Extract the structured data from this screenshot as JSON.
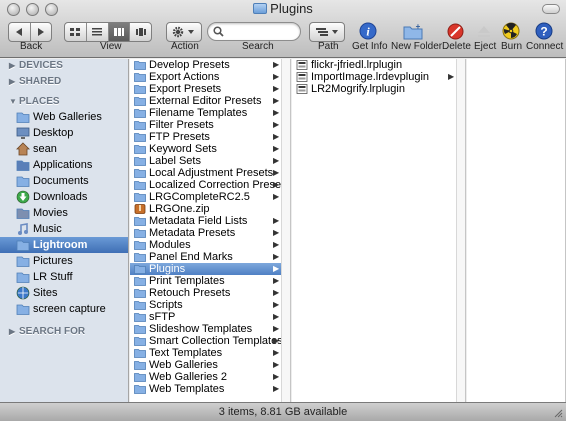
{
  "window": {
    "title": "Plugins"
  },
  "toolbar": {
    "back_label": "Back",
    "view_label": "View",
    "action_label": "Action",
    "search_label": "Search",
    "search_value": "",
    "path_label": "Path",
    "getinfo_label": "Get Info",
    "newfolder_label": "New Folder",
    "delete_label": "Delete",
    "eject_label": "Eject",
    "burn_label": "Burn",
    "connect_label": "Connect"
  },
  "sidebar": {
    "devices": "DEVICES",
    "shared": "SHARED",
    "places": "PLACES",
    "search_for": "SEARCH FOR",
    "items": [
      {
        "label": "Web Galleries",
        "icon": "folder-icon"
      },
      {
        "label": "Desktop",
        "icon": "desktop-icon"
      },
      {
        "label": "sean",
        "icon": "home-icon"
      },
      {
        "label": "Applications",
        "icon": "applications-icon"
      },
      {
        "label": "Documents",
        "icon": "documents-icon"
      },
      {
        "label": "Downloads",
        "icon": "downloads-icon"
      },
      {
        "label": "Movies",
        "icon": "movies-icon"
      },
      {
        "label": "Music",
        "icon": "music-icon"
      },
      {
        "label": "Lightroom",
        "icon": "folder-icon",
        "selected": true
      },
      {
        "label": "Pictures",
        "icon": "pictures-icon"
      },
      {
        "label": "LR Stuff",
        "icon": "folder-icon"
      },
      {
        "label": "Sites",
        "icon": "sites-icon"
      },
      {
        "label": "screen capture",
        "icon": "folder-icon"
      }
    ]
  },
  "column1": [
    {
      "label": "Develop Presets",
      "kind": "folder"
    },
    {
      "label": "Export Actions",
      "kind": "folder"
    },
    {
      "label": "Export Presets",
      "kind": "folder"
    },
    {
      "label": "External Editor Presets",
      "kind": "folder"
    },
    {
      "label": "Filename Templates",
      "kind": "folder"
    },
    {
      "label": "Filter Presets",
      "kind": "folder"
    },
    {
      "label": "FTP Presets",
      "kind": "folder"
    },
    {
      "label": "Keyword Sets",
      "kind": "folder"
    },
    {
      "label": "Label Sets",
      "kind": "folder"
    },
    {
      "label": "Local Adjustment Presets",
      "kind": "folder"
    },
    {
      "label": "Localized Correction Presets",
      "kind": "folder"
    },
    {
      "label": "LRGCompleteRC2.5",
      "kind": "folder"
    },
    {
      "label": "LRGOne.zip",
      "kind": "zip"
    },
    {
      "label": "Metadata Field Lists",
      "kind": "folder"
    },
    {
      "label": "Metadata Presets",
      "kind": "folder"
    },
    {
      "label": "Modules",
      "kind": "folder"
    },
    {
      "label": "Panel End Marks",
      "kind": "folder"
    },
    {
      "label": "Plugins",
      "kind": "folder",
      "selected": true
    },
    {
      "label": "Print Templates",
      "kind": "folder"
    },
    {
      "label": "Retouch Presets",
      "kind": "folder"
    },
    {
      "label": "Scripts",
      "kind": "folder"
    },
    {
      "label": "sFTP",
      "kind": "folder"
    },
    {
      "label": "Slideshow Templates",
      "kind": "folder"
    },
    {
      "label": "Smart Collection Templates",
      "kind": "folder"
    },
    {
      "label": "Text Templates",
      "kind": "folder"
    },
    {
      "label": "Web Galleries",
      "kind": "folder"
    },
    {
      "label": "Web Galleries 2",
      "kind": "folder"
    },
    {
      "label": "Web Templates",
      "kind": "folder"
    }
  ],
  "column2": [
    {
      "label": "flickr-jfriedl.lrplugin",
      "kind": "plugin",
      "arrow": false
    },
    {
      "label": "ImportImage.lrdevplugin",
      "kind": "plugin",
      "arrow": true
    },
    {
      "label": "LR2Mogrify.lrplugin",
      "kind": "plugin",
      "arrow": false
    }
  ],
  "status": {
    "text": "3 items, 8.81 GB available"
  }
}
